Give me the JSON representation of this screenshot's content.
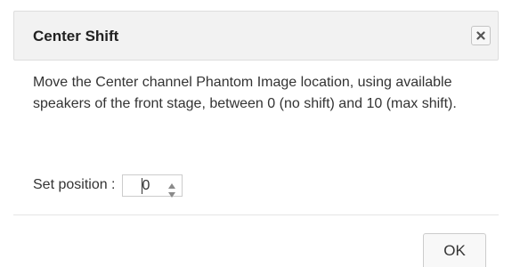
{
  "dialog": {
    "title": "Center Shift",
    "close_icon": "close-icon",
    "description": "Move the Center channel Phantom Image location, using available speakers of the front stage, between 0 (no shift) and 10 (max shift).",
    "position_label": "Set position :",
    "position_value": "0",
    "position_min": "0",
    "position_max": "10",
    "ok_label": "OK"
  },
  "colors": {
    "header_bg": "#f2f2f2",
    "text": "#333333",
    "border": "#cccccc"
  }
}
